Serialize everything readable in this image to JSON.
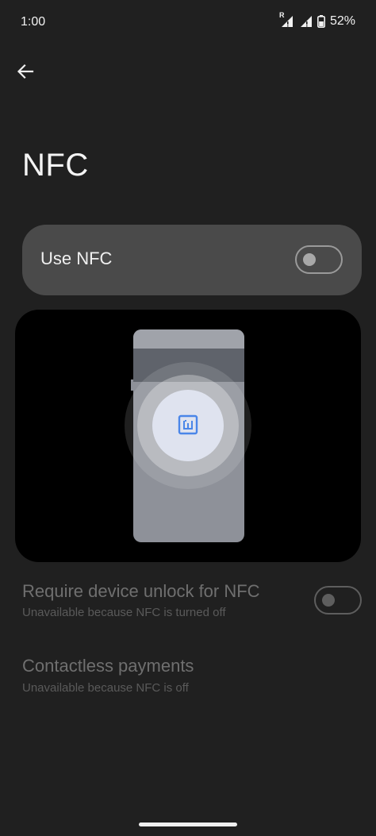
{
  "status_bar": {
    "time": "1:00",
    "battery_percent": "52%",
    "roaming_indicator": "R",
    "icons": [
      "signal-roaming-icon",
      "signal-alert-icon",
      "battery-icon"
    ]
  },
  "header": {
    "back_icon": "arrow-back-icon",
    "title": "NFC"
  },
  "use_nfc": {
    "label": "Use NFC",
    "enabled": false
  },
  "illustration": {
    "icon": "nfc-icon",
    "accent_color": "#4a86e8"
  },
  "settings": [
    {
      "title": "Require device unlock for NFC",
      "subtitle": "Unavailable because NFC is turned off",
      "has_toggle": true,
      "enabled": false
    },
    {
      "title": "Contactless payments",
      "subtitle": "Unavailable because NFC is off",
      "has_toggle": false
    }
  ],
  "colors": {
    "background": "#202020",
    "card": "#4a4a4a",
    "disabled_text": "#6f6f6f"
  }
}
